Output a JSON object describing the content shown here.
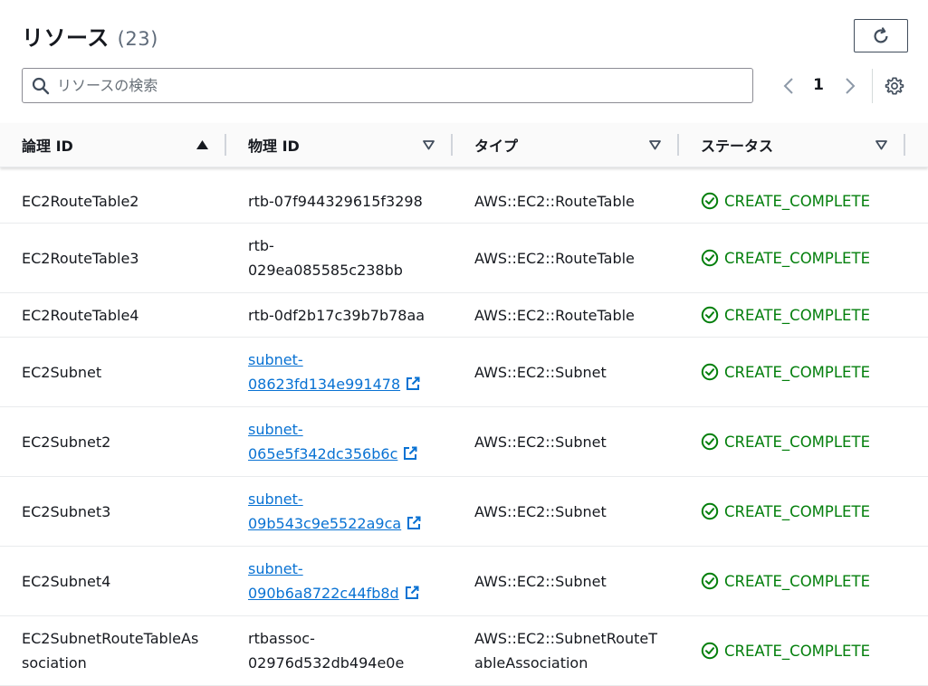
{
  "header": {
    "title": "リソース",
    "count": "(23)"
  },
  "search": {
    "placeholder": "リソースの検索",
    "value": ""
  },
  "pagination": {
    "current_page": "1"
  },
  "icons": {
    "refresh": "refresh-icon",
    "search": "search-icon",
    "prev": "chevron-left-icon",
    "next": "chevron-right-icon",
    "settings": "gear-icon",
    "external": "external-link-icon",
    "status": "check-circle-icon"
  },
  "colors": {
    "link": "#0972d3",
    "success": "#037f0c",
    "text": "#16191f"
  },
  "table": {
    "columns": [
      {
        "label": "論理 ID",
        "sort": "ascending"
      },
      {
        "label": "物理 ID",
        "sort": "none"
      },
      {
        "label": "タイプ",
        "sort": "none"
      },
      {
        "label": "ステータス",
        "sort": "none"
      }
    ],
    "rows": [
      {
        "logical_id": [
          "EC2RouteTable2"
        ],
        "physical_id": [
          "rtb-07f944329615f3298"
        ],
        "physical_link": false,
        "type": [
          "AWS::EC2::RouteTable"
        ],
        "status": "CREATE_COMPLETE"
      },
      {
        "logical_id": [
          "EC2RouteTable3"
        ],
        "physical_id": [
          "rtb-",
          "029ea085585c238bb"
        ],
        "physical_link": false,
        "type": [
          "AWS::EC2::RouteTable"
        ],
        "status": "CREATE_COMPLETE"
      },
      {
        "logical_id": [
          "EC2RouteTable4"
        ],
        "physical_id": [
          "rtb-0df2b17c39b7b78aa"
        ],
        "physical_link": false,
        "type": [
          "AWS::EC2::RouteTable"
        ],
        "status": "CREATE_COMPLETE"
      },
      {
        "logical_id": [
          "EC2Subnet"
        ],
        "physical_id": [
          "subnet-",
          "08623fd134e991478"
        ],
        "physical_link": true,
        "type": [
          "AWS::EC2::Subnet"
        ],
        "status": "CREATE_COMPLETE"
      },
      {
        "logical_id": [
          "EC2Subnet2"
        ],
        "physical_id": [
          "subnet-",
          "065e5f342dc356b6c"
        ],
        "physical_link": true,
        "type": [
          "AWS::EC2::Subnet"
        ],
        "status": "CREATE_COMPLETE"
      },
      {
        "logical_id": [
          "EC2Subnet3"
        ],
        "physical_id": [
          "subnet-",
          "09b543c9e5522a9ca"
        ],
        "physical_link": true,
        "type": [
          "AWS::EC2::Subnet"
        ],
        "status": "CREATE_COMPLETE"
      },
      {
        "logical_id": [
          "EC2Subnet4"
        ],
        "physical_id": [
          "subnet-",
          "090b6a8722c44fb8d"
        ],
        "physical_link": true,
        "type": [
          "AWS::EC2::Subnet"
        ],
        "status": "CREATE_COMPLETE"
      },
      {
        "logical_id": [
          "EC2SubnetRouteTableAs",
          "sociation"
        ],
        "physical_id": [
          "rtbassoc-",
          "02976d532db494e0e"
        ],
        "physical_link": false,
        "type": [
          "AWS::EC2::SubnetRouteT",
          "ableAssociation"
        ],
        "status": "CREATE_COMPLETE"
      }
    ]
  }
}
